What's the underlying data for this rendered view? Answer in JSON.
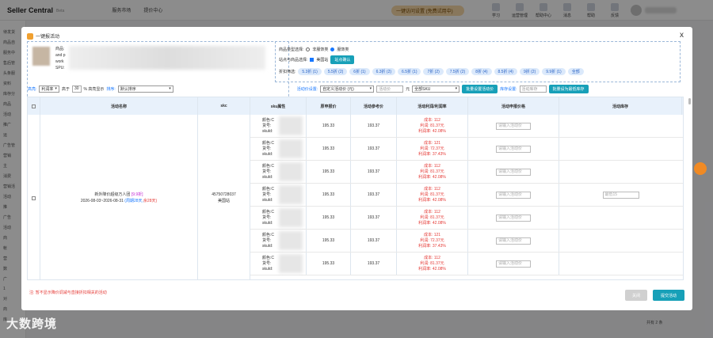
{
  "app": {
    "title": "Seller Central",
    "beta": "Beta",
    "nav": [
      "服务市场",
      "提价中心"
    ],
    "promo": "一键访问设置 (免费试用中)",
    "top_icons": [
      "学习",
      "运营管理",
      "帮助中心",
      "消息",
      "帮助",
      "反馈"
    ]
  },
  "sidebar": [
    "待发货",
    "商品自",
    "服务中",
    "售后管",
    "头条服",
    "资料",
    "库存分",
    "商品",
    "活动",
    "推广",
    "运",
    "广告管",
    "营销",
    "主",
    "消费",
    "营销活",
    "活动",
    "推",
    "广告",
    "活动",
    "商",
    "帐",
    "营",
    "数",
    "广",
    "1",
    "对",
    "商",
    "库"
  ],
  "modal": {
    "title": "一键报活动",
    "close": "x",
    "product": {
      "lines": [
        "商品:",
        "and p",
        "work",
        "SPU:"
      ]
    },
    "filters": {
      "type_label": "商品类型选择:",
      "type_opt1": "非服饰类",
      "type_opt2": "服饰类",
      "site_label": "站点与商品选择:",
      "site_opt": "美国站",
      "confirm": "站点确认",
      "discount_label": "折扣筛选:",
      "discounts": [
        "5.3折 (1)",
        "5.5折 (2)",
        "6折 (1)",
        "6.3折 (2)",
        "6.5折 (1)",
        "7折 (2)",
        "7.5折 (2)",
        "8折 (4)",
        "8.5折 (4)",
        "9折 (2)",
        "9.9折 (1)",
        "全部"
      ]
    },
    "controls": {
      "highlight": "高亮:",
      "profit_sel": "利润率",
      "gte": "高于",
      "pct": "30",
      "pct_label": "% 高亮显示",
      "sort_label": "排序:",
      "sort_sel": "默认排序",
      "price_label": "活动价设置:",
      "price_sel": "自定义活动价 (元)",
      "price_ph": "活动价",
      "yuan": "元",
      "sku_sel": "全部SKU",
      "batch_price": "批量设置活动价",
      "stock_label": "库存设置:",
      "stock_ph": "活动库存",
      "batch_stock": "批量设为最低库存"
    },
    "table": {
      "headers": [
        "活动名称",
        "skc",
        "sku属性",
        "原申报价",
        "活动参考价",
        "活动利润/利润率",
        "活动申报价格",
        "活动库存"
      ],
      "activity": {
        "name": "新外降价超级万人团",
        "discount": "[9.9折]",
        "period": "2026-08-03~2026-08-31",
        "days": "(周期28天,",
        "remain": "余28天)"
      },
      "skc": {
        "id": "45750728037",
        "site": "美国站"
      },
      "stock_ph": "最低15",
      "rows": [
        {
          "attrs": [
            "颜色:C",
            "货号:",
            "skuId:"
          ],
          "declared": "195.33",
          "ref": "193.37",
          "cost": "成本: 112",
          "profit": "利润: 81.37元",
          "rate": "利润率: 42.08%",
          "ph": "请输入活动价"
        },
        {
          "attrs": [
            "颜色:C",
            "货号:",
            "skuId:"
          ],
          "declared": "195.33",
          "ref": "193.37",
          "cost": "成本: 121",
          "profit": "利润: 72.37元",
          "rate": "利润率: 37.43%",
          "ph": "请输入活动价"
        },
        {
          "attrs": [
            "颜色:C",
            "货号:",
            "skuId:"
          ],
          "declared": "195.33",
          "ref": "193.37",
          "cost": "成本: 112",
          "profit": "利润: 81.37元",
          "rate": "利润率: 42.08%",
          "ph": "请输入活动价"
        },
        {
          "attrs": [
            "颜色:C",
            "货号:",
            "skuId:"
          ],
          "declared": "195.33",
          "ref": "193.37",
          "cost": "成本: 112",
          "profit": "利润: 81.37元",
          "rate": "利润率: 42.08%",
          "ph": "请输入活动价"
        },
        {
          "attrs": [
            "颜色:C",
            "货号:",
            "skuId:"
          ],
          "declared": "195.33",
          "ref": "193.37",
          "cost": "成本: 112",
          "profit": "利润: 81.37元",
          "rate": "利润率: 42.08%",
          "ph": "请输入活动价"
        },
        {
          "attrs": [
            "颜色:C",
            "货号:",
            "skuId:"
          ],
          "declared": "195.33",
          "ref": "193.37",
          "cost": "成本: 121",
          "profit": "利润: 72.37元",
          "rate": "利润率: 37.43%",
          "ph": "请输入活动价"
        },
        {
          "attrs": [
            "颜色:C",
            "货号:",
            "skuId:"
          ],
          "declared": "195.33",
          "ref": "193.37",
          "cost": "成本: 112",
          "profit": "利润: 81.37元",
          "rate": "利润率: 42.08%",
          "ph": "请输入活动价"
        }
      ]
    },
    "note": "注: 暂不显示降价调减与直接折扣相关的活动",
    "close_btn": "关闭",
    "submit_btn": "提交活动"
  },
  "watermark": "大数跨境",
  "pager": "共有 2 条"
}
